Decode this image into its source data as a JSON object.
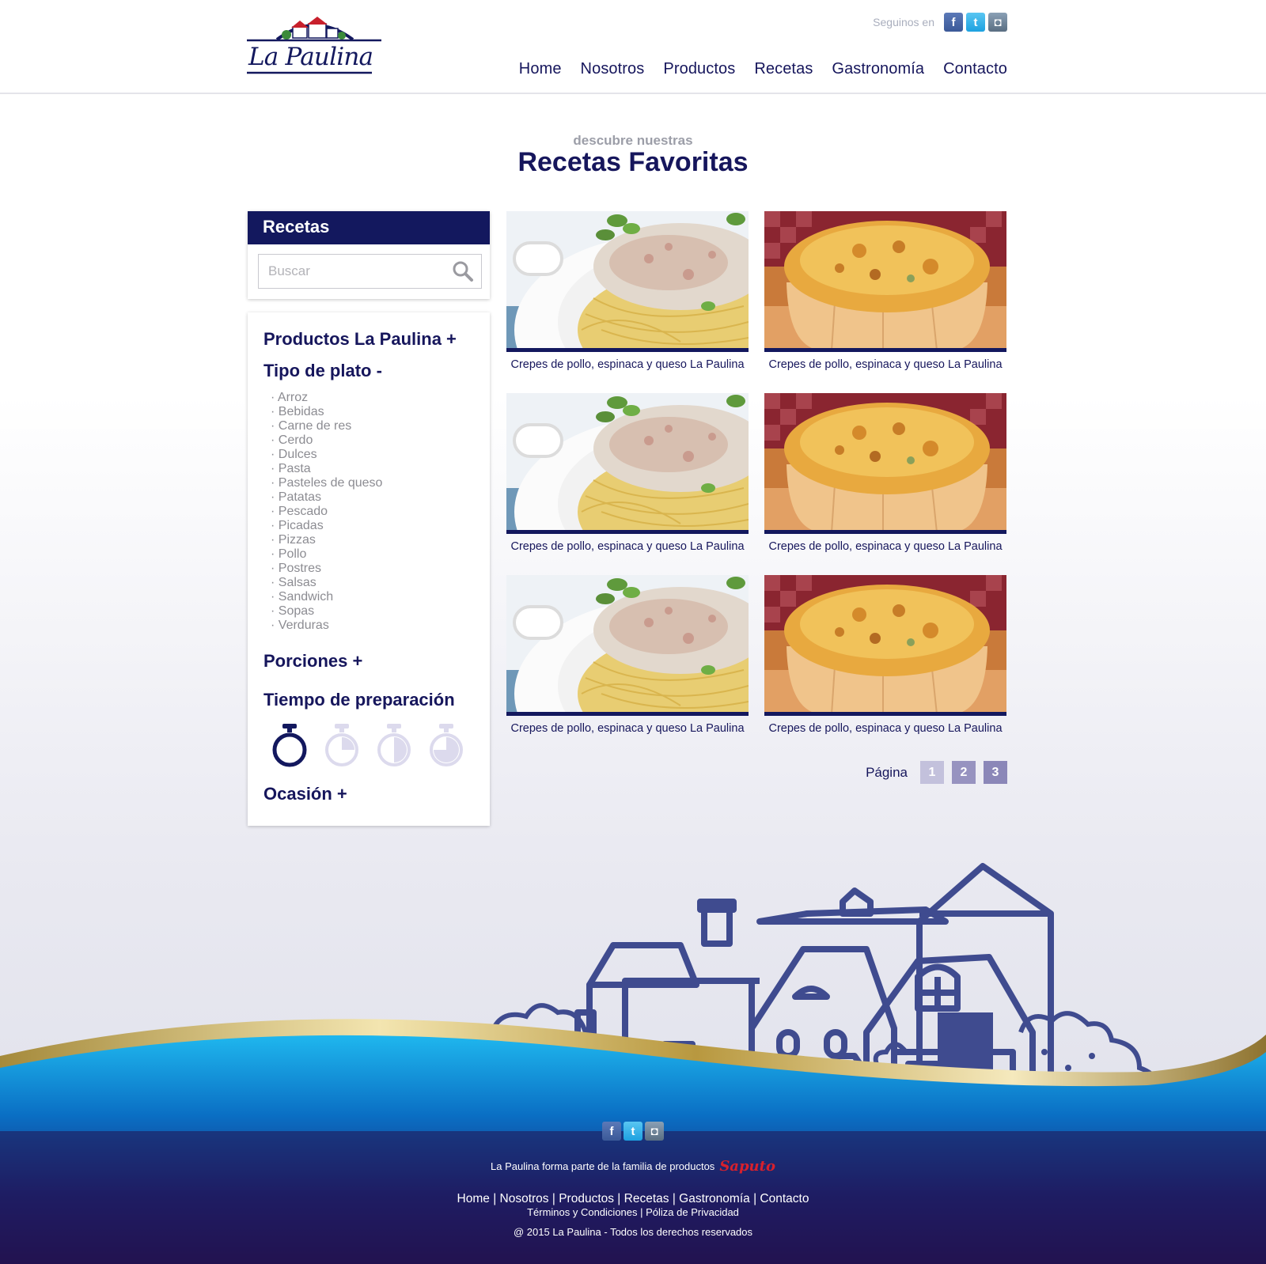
{
  "brand": {
    "name": "La Paulina"
  },
  "header": {
    "social_label": "Seguinos en",
    "social": [
      {
        "icon": "facebook-icon",
        "glyph": "f"
      },
      {
        "icon": "twitter-icon",
        "glyph": "t"
      },
      {
        "icon": "instagram-icon",
        "glyph": "◘"
      }
    ],
    "nav": [
      "Home",
      "Nosotros",
      "Productos",
      "Recetas",
      "Gastronomía",
      "Contacto"
    ]
  },
  "hero": {
    "subtitle": "descubre nuestras",
    "title": "Recetas Favoritas"
  },
  "sidebar": {
    "search_title": "Recetas",
    "search_placeholder": "Buscar",
    "filters": {
      "productos": "Productos La Paulina +",
      "tipo": "Tipo de plato -",
      "tipo_items": [
        "· Arroz",
        "· Bebidas",
        "· Carne de res",
        "· Cerdo",
        "· Dulces",
        "· Pasta",
        "· Pasteles de queso",
        "· Patatas",
        "· Pescado",
        "· Picadas",
        "· Pizzas",
        "· Pollo",
        "· Postres",
        "· Salsas",
        "· Sandwich",
        "· Sopas",
        "· Verduras"
      ],
      "porciones": "Porciones +",
      "tiempo": "Tiempo de preparación",
      "ocasion": "Ocasión +"
    }
  },
  "recipes": [
    {
      "caption": "Crepes de pollo, espinaca y queso La Paulina",
      "image": "pasta"
    },
    {
      "caption": "Crepes de pollo, espinaca y queso La Paulina",
      "image": "quiche"
    },
    {
      "caption": "Crepes de pollo, espinaca y queso La Paulina",
      "image": "pasta"
    },
    {
      "caption": "Crepes de pollo, espinaca y queso La Paulina",
      "image": "quiche"
    },
    {
      "caption": "Crepes de pollo, espinaca y queso La Paulina",
      "image": "pasta"
    },
    {
      "caption": "Crepes de pollo, espinaca y queso La Paulina",
      "image": "quiche"
    }
  ],
  "pagination": {
    "label": "Página",
    "pages": [
      "1",
      "2",
      "3"
    ]
  },
  "footer": {
    "family_text": "La Paulina forma parte de la familia de productos",
    "partner": "Saputo",
    "links": [
      "Home",
      "Nosotros",
      "Productos",
      "Recetas",
      "Gastronomía",
      "Contacto"
    ],
    "legal": [
      "Términos y Condiciones",
      "Póliza de Privacidad"
    ],
    "copyright": "@ 2015 La Paulina - Todos los derechos reservados"
  },
  "colors": {
    "navy": "#13185e",
    "gold": "#b89a4a",
    "blue": "#0a7fcf",
    "footer_bg": "#231350"
  }
}
